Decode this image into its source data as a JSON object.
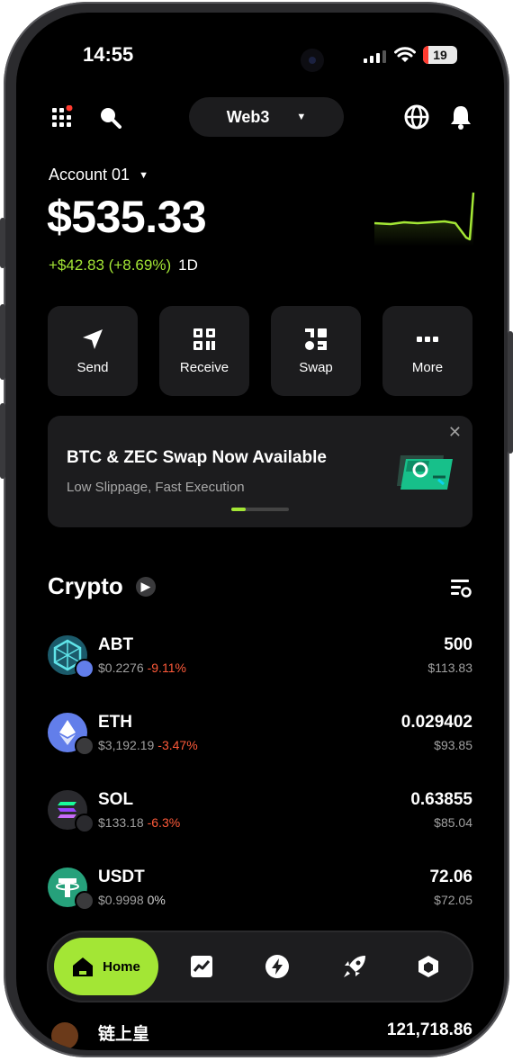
{
  "status": {
    "time": "14:55",
    "battery": "19"
  },
  "header": {
    "network_label": "Web3"
  },
  "account": {
    "name": "Account 01",
    "balance": "$535.33",
    "change": "+$42.83 (+8.69%)",
    "period": "1D"
  },
  "actions": [
    {
      "label": "Send",
      "icon": "send-icon"
    },
    {
      "label": "Receive",
      "icon": "qr-icon"
    },
    {
      "label": "Swap",
      "icon": "swap-icon"
    },
    {
      "label": "More",
      "icon": "more-icon"
    }
  ],
  "banner": {
    "title": "BTC & ZEC Swap Now Available",
    "subtitle": "Low Slippage, Fast Execution",
    "slide_progress": 0.25
  },
  "crypto": {
    "title": "Crypto",
    "items": [
      {
        "symbol": "ABT",
        "price": "$0.2276",
        "change": "-9.11%",
        "amount": "500",
        "value": "$113.83",
        "color": "#1b5a6a"
      },
      {
        "symbol": "ETH",
        "price": "$3,192.19",
        "change": "-3.47%",
        "amount": "0.029402",
        "value": "$93.85",
        "color": "#627eea"
      },
      {
        "symbol": "SOL",
        "price": "$133.18",
        "change": "-6.3%",
        "amount": "0.63855",
        "value": "$85.04",
        "color": "#2a2a2e"
      },
      {
        "symbol": "USDT",
        "price": "$0.9998",
        "change": "0%",
        "amount": "72.06",
        "value": "$72.05",
        "color": "#26a17b"
      }
    ],
    "partial_item": {
      "symbol": "链上皇",
      "amount": "121,718.86"
    }
  },
  "nav": {
    "home_label": "Home"
  },
  "colors": {
    "accent": "#a3e635",
    "negative": "#ff5a3a",
    "card": "#1c1c1e"
  }
}
